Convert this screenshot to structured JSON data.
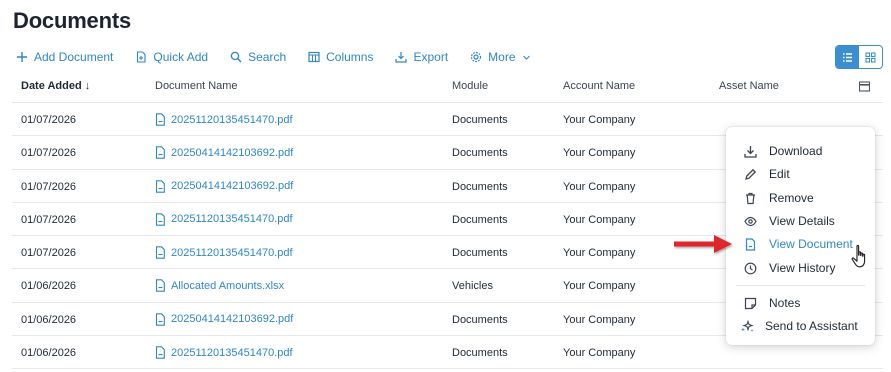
{
  "page": {
    "title": "Documents"
  },
  "toolbar": {
    "add_document": "Add Document",
    "quick_add": "Quick Add",
    "search": "Search",
    "columns": "Columns",
    "export": "Export",
    "more": "More"
  },
  "table": {
    "headers": {
      "date_added": "Date Added",
      "document_name": "Document Name",
      "module": "Module",
      "account_name": "Account Name",
      "asset_name": "Asset Name"
    },
    "rows": [
      {
        "date": "01/07/2026",
        "doc": "20251120135451470.pdf",
        "module": "Documents",
        "account": "Your Company",
        "asset": ""
      },
      {
        "date": "01/07/2026",
        "doc": "20250414142103692.pdf",
        "module": "Documents",
        "account": "Your Company",
        "asset": ""
      },
      {
        "date": "01/07/2026",
        "doc": "20250414142103692.pdf",
        "module": "Documents",
        "account": "Your Company",
        "asset": ""
      },
      {
        "date": "01/07/2026",
        "doc": "20251120135451470.pdf",
        "module": "Documents",
        "account": "Your Company",
        "asset": ""
      },
      {
        "date": "01/07/2026",
        "doc": "20251120135451470.pdf",
        "module": "Documents",
        "account": "Your Company",
        "asset": ""
      },
      {
        "date": "01/06/2026",
        "doc": "Allocated Amounts.xlsx",
        "module": "Vehicles",
        "account": "Your Company",
        "asset": ""
      },
      {
        "date": "01/06/2026",
        "doc": "20250414142103692.pdf",
        "module": "Documents",
        "account": "Your Company",
        "asset": ""
      },
      {
        "date": "01/06/2026",
        "doc": "20251120135451470.pdf",
        "module": "Documents",
        "account": "Your Company",
        "asset": ""
      }
    ]
  },
  "context_menu": {
    "items": [
      {
        "label": "Download",
        "icon": "download-icon"
      },
      {
        "label": "Edit",
        "icon": "pencil-icon"
      },
      {
        "label": "Remove",
        "icon": "trash-icon"
      },
      {
        "label": "View Details",
        "icon": "eye-icon"
      },
      {
        "label": "View Document",
        "icon": "document-icon"
      },
      {
        "label": "View History",
        "icon": "clock-icon"
      },
      {
        "label": "Notes",
        "icon": "note-icon"
      },
      {
        "label": "Send to Assistant",
        "icon": "sparkle-icon"
      }
    ],
    "highlighted": "View Document"
  },
  "colors": {
    "accent": "#2f86c8",
    "annotation_arrow": "#e0262a"
  }
}
